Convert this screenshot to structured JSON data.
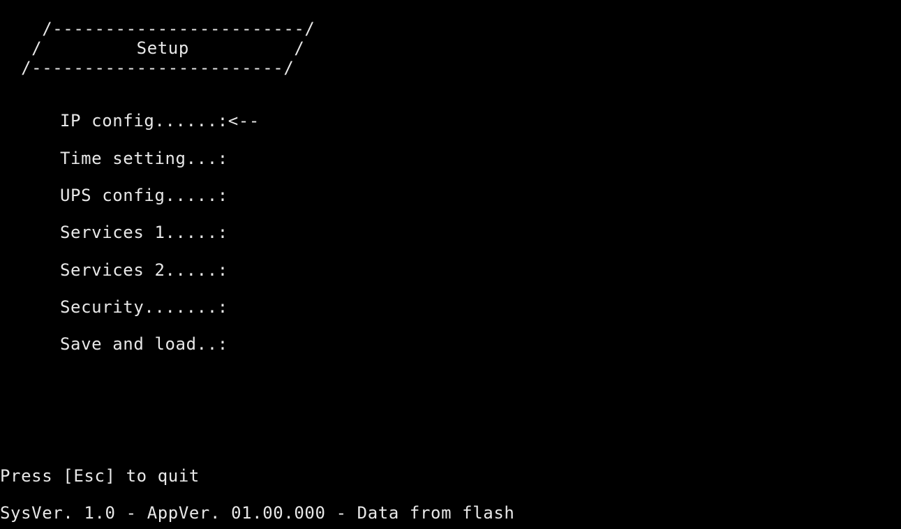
{
  "banner": {
    "top": "    /------------------------/",
    "middle": "   /         Setup          /",
    "bottom": "  /------------------------/"
  },
  "menu": {
    "items": [
      {
        "label": "IP config......:",
        "selected_marker": "<--"
      },
      {
        "label": "Time setting...:",
        "selected_marker": ""
      },
      {
        "label": "UPS config.....:",
        "selected_marker": ""
      },
      {
        "label": "Services 1.....:",
        "selected_marker": ""
      },
      {
        "label": "Services 2.....:",
        "selected_marker": ""
      },
      {
        "label": "Security.......:",
        "selected_marker": ""
      },
      {
        "label": "Save and load..:",
        "selected_marker": ""
      }
    ]
  },
  "footer": {
    "quit_hint": "Press [Esc] to quit",
    "version_info": "SysVer. 1.0 - AppVer. 01.00.000 - Data from flash"
  },
  "colors": {
    "background": "#000000",
    "text": "#e8e8e8"
  }
}
